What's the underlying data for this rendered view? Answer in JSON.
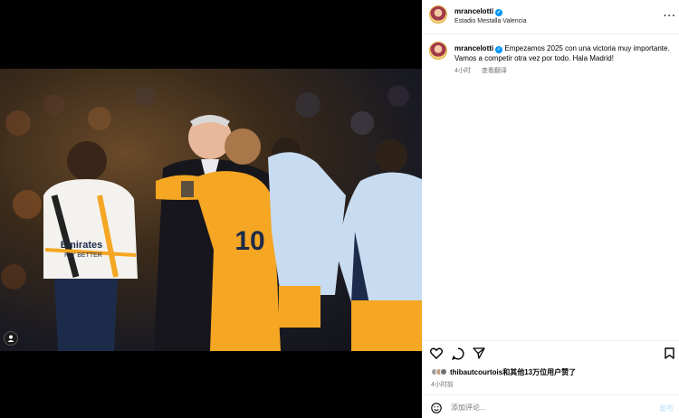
{
  "header": {
    "username": "mrancelotti",
    "location": "Estadio Mestalla Valencia"
  },
  "caption": {
    "username": "mrancelotti",
    "text": "Empezamos 2025 con una victoria muy importante. Vamos a competir otra vez por todo. Hala Madrid!",
    "time": "4小时",
    "translate": "查看翻译"
  },
  "photo": {
    "jersey_text_1": "Emirates",
    "jersey_text_2": "FLY BETTER",
    "jersey_number": "10"
  },
  "likes": {
    "user": "thibautcourtois",
    "rest": "和其他13万位用户赞了"
  },
  "timestamp": "4小时前",
  "comment": {
    "placeholder": "添加评论...",
    "post_label": "发布"
  },
  "colors": {
    "verified": "#0095f6",
    "orange_kit": "#f5a623",
    "jacket_blue": "#c7dcf0"
  }
}
